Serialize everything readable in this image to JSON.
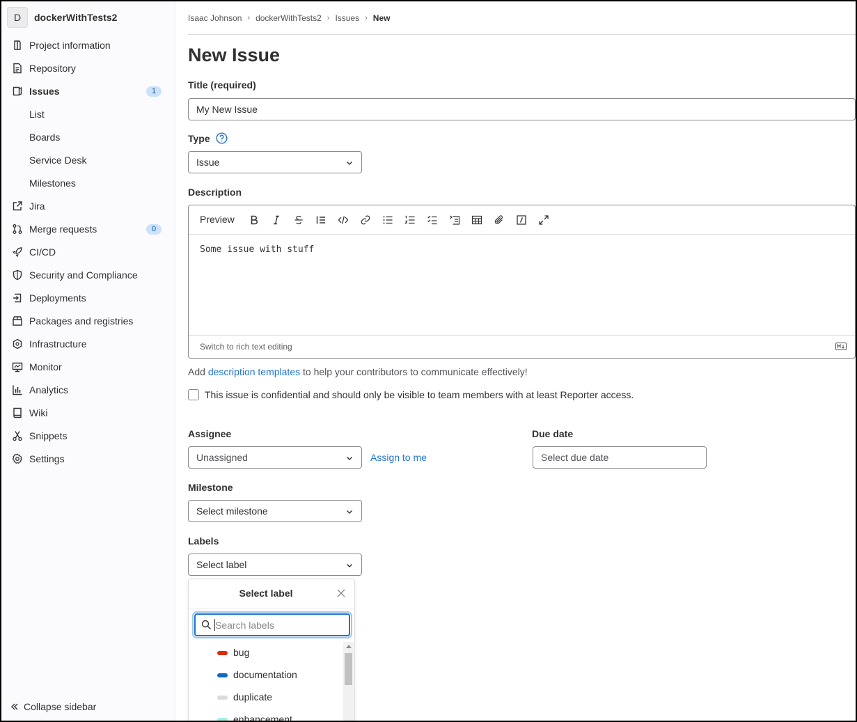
{
  "project": {
    "avatar_letter": "D",
    "name": "dockerWithTests2"
  },
  "sidebar": {
    "items": [
      {
        "label": "Project information",
        "icon": "project-info-icon"
      },
      {
        "label": "Repository",
        "icon": "repository-icon"
      },
      {
        "label": "Issues",
        "icon": "issues-icon",
        "badge": "1",
        "active": true
      },
      {
        "label": "List"
      },
      {
        "label": "Boards"
      },
      {
        "label": "Service Desk"
      },
      {
        "label": "Milestones"
      },
      {
        "label": "Jira",
        "icon": "external-link-icon"
      },
      {
        "label": "Merge requests",
        "icon": "merge-request-icon",
        "badge": "0"
      },
      {
        "label": "CI/CD",
        "icon": "rocket-icon"
      },
      {
        "label": "Security and Compliance",
        "icon": "shield-icon"
      },
      {
        "label": "Deployments",
        "icon": "deployments-icon"
      },
      {
        "label": "Packages and registries",
        "icon": "package-icon"
      },
      {
        "label": "Infrastructure",
        "icon": "infrastructure-icon"
      },
      {
        "label": "Monitor",
        "icon": "monitor-icon"
      },
      {
        "label": "Analytics",
        "icon": "chart-icon"
      },
      {
        "label": "Wiki",
        "icon": "book-icon"
      },
      {
        "label": "Snippets",
        "icon": "scissors-icon"
      },
      {
        "label": "Settings",
        "icon": "gear-icon"
      }
    ],
    "collapse_label": "Collapse sidebar"
  },
  "breadcrumbs": [
    "Isaac Johnson",
    "dockerWithTests2",
    "Issues",
    "New"
  ],
  "page_title": "New Issue",
  "form": {
    "title_label": "Title (required)",
    "title_value": "My New Issue",
    "type_label": "Type",
    "type_value": "Issue",
    "description_label": "Description",
    "toolbar_preview": "Preview",
    "description_value": "Some issue with stuff",
    "switch_editor": "Switch to rich text editing",
    "hint_before": "Add ",
    "hint_link": "description templates",
    "hint_after": " to help your contributors to communicate effectively!",
    "confidential_label": "This issue is confidential and should only be visible to team members with at least Reporter access.",
    "assignee_label": "Assignee",
    "assignee_value": "Unassigned",
    "assign_to_me": "Assign to me",
    "due_date_label": "Due date",
    "due_date_placeholder": "Select due date",
    "milestone_label": "Milestone",
    "milestone_value": "Select milestone",
    "labels_label": "Labels",
    "labels_value": "Select label"
  },
  "label_dropdown": {
    "title": "Select label",
    "search_placeholder": "Search labels",
    "options": [
      {
        "name": "bug",
        "color": "#dd2b0e"
      },
      {
        "name": "documentation",
        "color": "#1068bf"
      },
      {
        "name": "duplicate",
        "color": "#dcdcde"
      },
      {
        "name": "enhancement",
        "color": "#9ef0f0"
      }
    ]
  },
  "colors": {
    "link": "#1f75cb",
    "badge_bg": "#cbe2f9",
    "badge_text": "#0b5cad"
  }
}
